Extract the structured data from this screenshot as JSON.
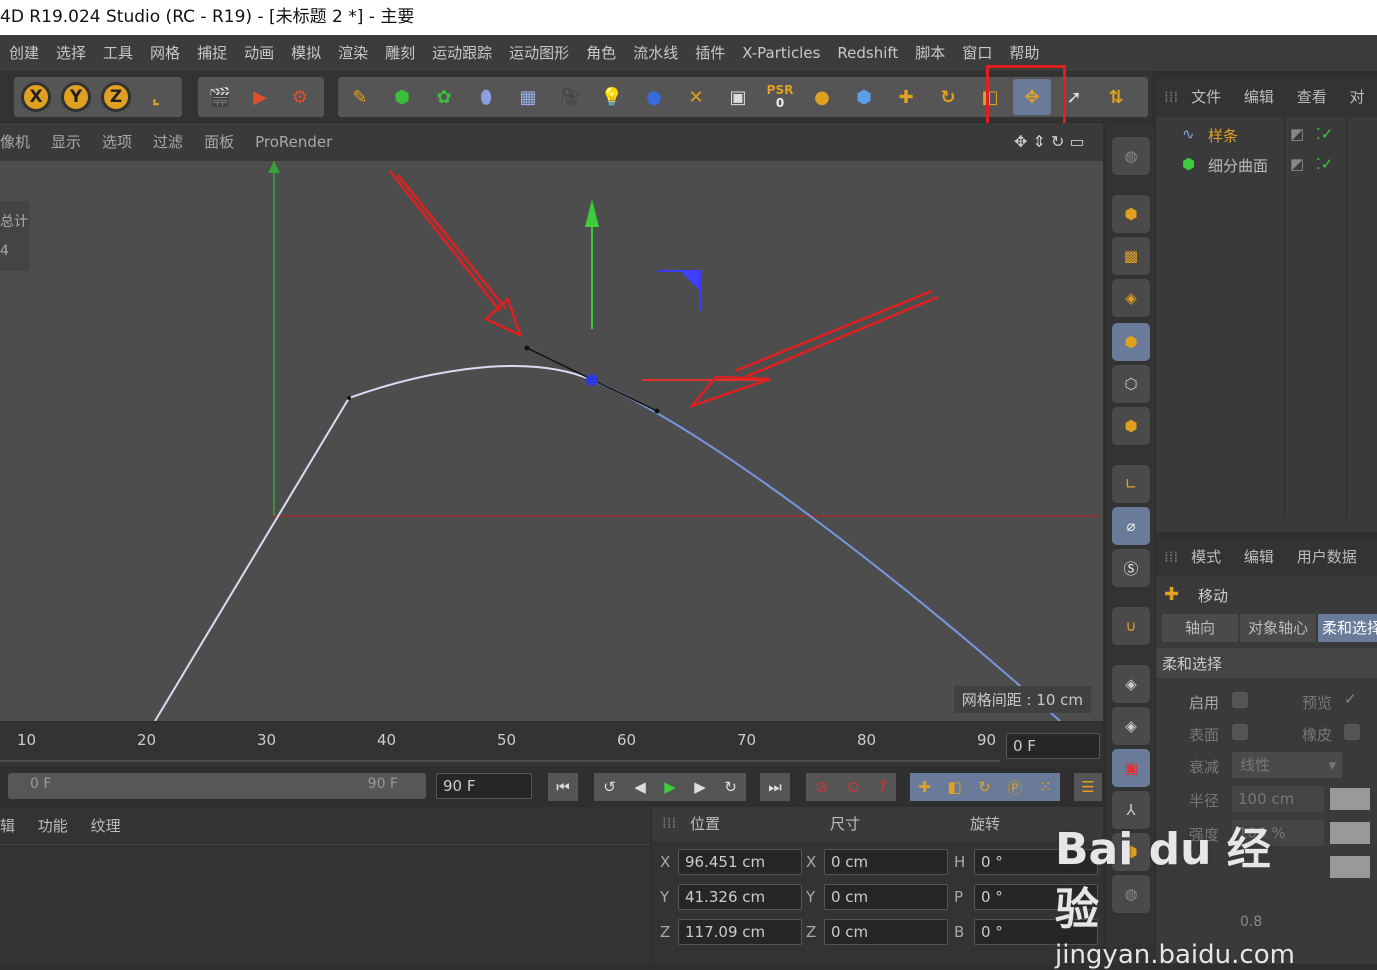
{
  "window": {
    "title": "4D R19.024 Studio (RC - R19) - [未标题 2 *] - 主要"
  },
  "menu": [
    "创建",
    "选择",
    "工具",
    "网格",
    "捕捉",
    "动画",
    "模拟",
    "渲染",
    "雕刻",
    "运动跟踪",
    "运动图形",
    "角色",
    "流水线",
    "插件",
    "X-Particles",
    "Redshift",
    "脚本",
    "窗口",
    "帮助"
  ],
  "toolbar": {
    "x_label": "X",
    "y_label": "Y",
    "z_label": "Z",
    "psr_label": "PSR",
    "psr_value": "0"
  },
  "viewport_menu": [
    "像机",
    "显示",
    "选项",
    "过滤",
    "面板",
    "ProRender"
  ],
  "hud": {
    "line1": "总计",
    "line2": "4"
  },
  "viewport": {
    "grid_spacing": "网格间距 : 10 cm"
  },
  "timeline": {
    "ticks": [
      "10",
      "20",
      "30",
      "40",
      "50",
      "60",
      "70",
      "80",
      "90"
    ],
    "current_frame": "0 F"
  },
  "transport": {
    "range_start": "0 F",
    "range_end": "90 F",
    "max_frame": "90 F"
  },
  "objects": {
    "menu": [
      "文件",
      "编辑",
      "查看",
      "对"
    ],
    "items": [
      {
        "name": "样条"
      },
      {
        "name": "细分曲面"
      }
    ]
  },
  "attributes": {
    "menu": [
      "模式",
      "编辑",
      "用户数据"
    ],
    "tool_name": "移动",
    "tabs": [
      "轴向",
      "对象轴心",
      "柔和选择"
    ],
    "section": "柔和选择",
    "enable_label": "启用",
    "preview_label": "预览",
    "surface_label": "表面",
    "rubber_label": "橡皮",
    "falloff_label": "衰减",
    "falloff_value": "线性",
    "radius_label": "半径",
    "radius_value": "100 cm",
    "strength_label": "强度",
    "strength_value": "100 %",
    "graph_value": "0.8"
  },
  "bottom_left_menu": [
    "辑",
    "功能",
    "纹理"
  ],
  "coordinates": {
    "headers": {
      "position": "位置",
      "size": "尺寸",
      "rotation": "旋转"
    },
    "rows": [
      {
        "axis": "X",
        "pos": "96.451 cm",
        "size_axis": "X",
        "size": "0 cm",
        "rot_axis": "H",
        "rot": "0 °"
      },
      {
        "axis": "Y",
        "pos": "41.326 cm",
        "size_axis": "Y",
        "size": "0 cm",
        "rot_axis": "P",
        "rot": "0 °"
      },
      {
        "axis": "Z",
        "pos": "117.09 cm",
        "size_axis": "Z",
        "size": "0 cm",
        "rot_axis": "B",
        "rot": "0 °"
      }
    ]
  },
  "watermark": {
    "brand": "Bai du 经验",
    "url": "jingyan.baidu.com"
  },
  "colors": {
    "accent": "#e0a020",
    "highlight_box": "#e02020",
    "arrow": "#e02020",
    "spline": "#8aa2e0"
  }
}
